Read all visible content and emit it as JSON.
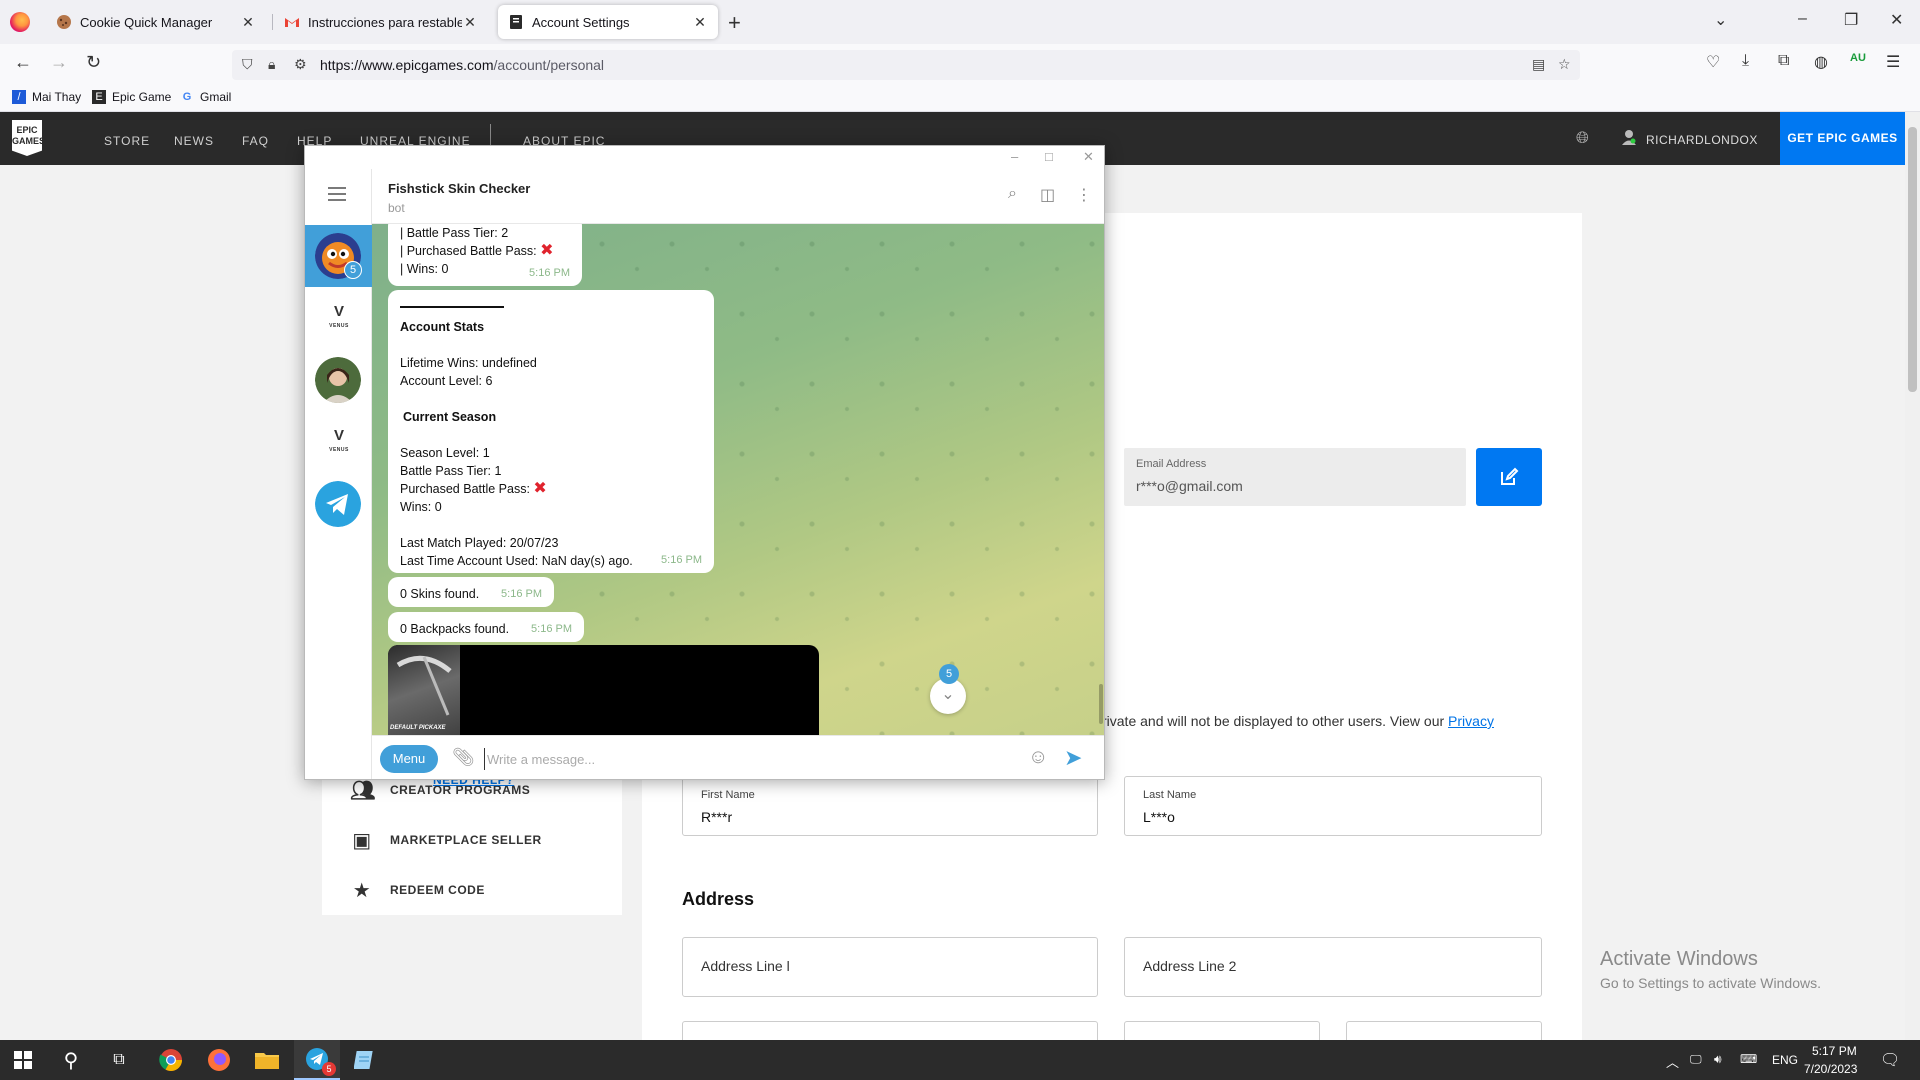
{
  "browser": {
    "tabs": [
      {
        "title": "Cookie Quick Manager",
        "active": false
      },
      {
        "title": "Instrucciones para restablecer la contraseña",
        "active": false
      },
      {
        "title": "Account Settings",
        "active": true
      }
    ],
    "url_domain": "https://www.epicgames.com",
    "url_path": "/account/personal",
    "bookmarks": [
      "Mai Thay",
      "Epic Game",
      "Gmail"
    ],
    "profile_badge": "AU"
  },
  "epic": {
    "logo_text": "EPIC GAMES",
    "nav_links": [
      "STORE",
      "NEWS",
      "FAQ",
      "HELP",
      "UNREAL ENGINE",
      "ABOUT EPIC"
    ],
    "username": "RICHARDLONDOX",
    "cta": "GET EPIC GAMES",
    "sidebar": [
      {
        "label": "CREATOR PROGRAMS",
        "icon": "people-icon"
      },
      {
        "label": "MARKETPLACE SELLER",
        "icon": "store-icon"
      },
      {
        "label": "REDEEM CODE",
        "icon": "star-icon"
      }
    ],
    "need_help": "NEED HELP?",
    "email": {
      "label": "Email Address",
      "value": "r***o@gmail.com"
    },
    "privacy_text": "rivate and will not be displayed to other users. View our",
    "privacy_link": "Privacy",
    "first_name": {
      "label": "First Name",
      "value": "R***r"
    },
    "last_name": {
      "label": "Last Name",
      "value": "L***o"
    },
    "address_title": "Address",
    "address_line1": "Address Line l",
    "address_line2": "Address Line 2"
  },
  "telegram": {
    "chat_name": "Fishstick Skin Checker",
    "chat_status": "bot",
    "rail_badge": "5",
    "msg1": {
      "lines": [
        "| Battle Pass Tier: 2",
        "| Purchased Battle Pass:",
        "| Wins: 0"
      ],
      "time": "5:16 PM"
    },
    "msg2": {
      "heading1": "Account Stats",
      "lifetime_wins": "Lifetime Wins: undefined",
      "account_level": "Account Level: 6",
      "heading2": "Current Season",
      "season_level": "Season Level: 1",
      "bp_tier": "Battle Pass Tier: 1",
      "purchased_bp": "Purchased Battle Pass:",
      "wins": "Wins: 0",
      "last_match": "Last Match Played: 20/07/23",
      "last_used": "Last Time Account Used: NaN day(s) ago.",
      "time": "5:16 PM"
    },
    "msg3": {
      "text": "0 Skins found.",
      "time": "5:16 PM"
    },
    "msg4": {
      "text": "0 Backpacks found.",
      "time": "5:16 PM"
    },
    "image_caption": "DEFAULT PICKAXE",
    "unread_count": "5",
    "menu_label": "Menu",
    "input_placeholder": "Write a message..."
  },
  "activate_windows": {
    "line1": "Activate Windows",
    "line2": "Go to Settings to activate Windows."
  },
  "taskbar": {
    "time": "5:17 PM",
    "date": "7/20/2023",
    "lang": "ENG",
    "telegram_badge": "5"
  }
}
